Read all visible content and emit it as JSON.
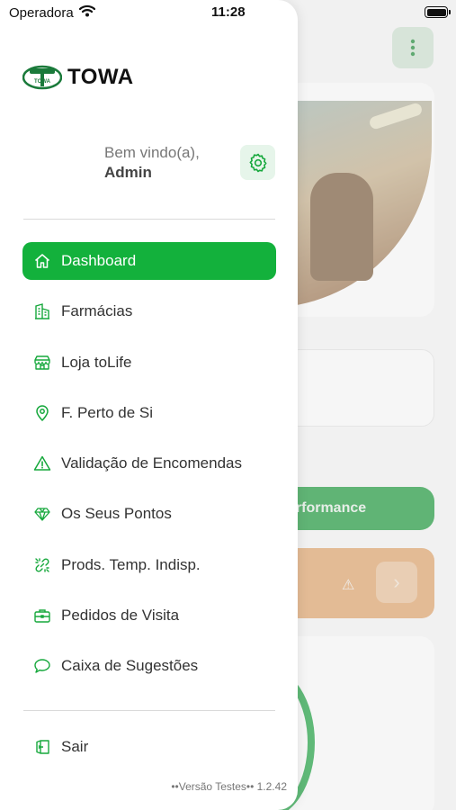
{
  "status_bar": {
    "carrier": "Operadora",
    "time": "11:28"
  },
  "brand": {
    "name": "TOWA",
    "logo_mark": "TOWA"
  },
  "welcome": {
    "greeting": "Bem vindo(a),",
    "user": "Admin"
  },
  "menu": [
    {
      "label": "Dashboard",
      "icon": "home-icon",
      "active": true
    },
    {
      "label": "Farmácias",
      "icon": "building-icon"
    },
    {
      "label": "Loja toLife",
      "icon": "store-icon"
    },
    {
      "label": "F. Perto de Si",
      "icon": "map-pin-icon"
    },
    {
      "label": "Validação de Encomendas",
      "icon": "warning-icon"
    },
    {
      "label": "Os Seus Pontos",
      "icon": "diamond-icon"
    },
    {
      "label": "Prods. Temp. Indisp.",
      "icon": "broken-link-icon"
    },
    {
      "label": "Pedidos de Visita",
      "icon": "briefcase-icon"
    },
    {
      "label": "Caixa de Sugestões",
      "icon": "chat-icon"
    }
  ],
  "logout": {
    "label": "Sair",
    "icon": "exit-door-icon"
  },
  "version": "••Versão Testes•• 1.2.42",
  "background": {
    "performance_label": "erformance"
  },
  "colors": {
    "accent": "#13b13c",
    "accent_light": "#e6f5ea",
    "alert": "#e2a56b"
  }
}
